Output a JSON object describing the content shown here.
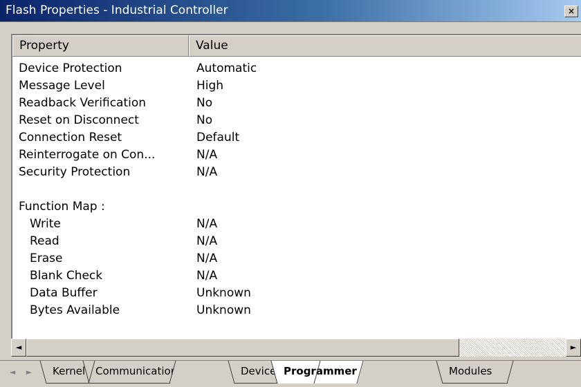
{
  "window": {
    "title": "Flash Properties - Industrial Controller",
    "close_glyph": "×"
  },
  "columns": {
    "property": "Property",
    "value": "Value"
  },
  "rows": [
    {
      "property": "Device Protection",
      "value": "Automatic"
    },
    {
      "property": "Message Level",
      "value": "High"
    },
    {
      "property": "Readback Verification",
      "value": "No"
    },
    {
      "property": "Reset on Disconnect",
      "value": "No"
    },
    {
      "property": "Connection Reset",
      "value": "Default"
    },
    {
      "property": "Reinterrogate on Con...",
      "value": "N/A"
    },
    {
      "property": "Security Protection",
      "value": "N/A"
    },
    {
      "property": "",
      "value": ""
    },
    {
      "property": "Function Map :",
      "value": ""
    },
    {
      "property": "Write",
      "value": "N/A"
    },
    {
      "property": "Read",
      "value": "N/A"
    },
    {
      "property": "Erase",
      "value": "N/A"
    },
    {
      "property": "Blank Check",
      "value": "N/A"
    },
    {
      "property": "Data Buffer",
      "value": "Unknown"
    },
    {
      "property": "Bytes Available",
      "value": "Unknown"
    }
  ],
  "scrollbar": {
    "left_glyph": "◄",
    "right_glyph": "►"
  },
  "tabs": {
    "nav_left_glyph": "◄",
    "nav_right_glyph": "►",
    "kernel": "Kernel",
    "communications": "Communications",
    "device": "Device",
    "programmer": "Programmer",
    "modules": "Modules",
    "active": "Programmer"
  },
  "colors": {
    "titlebar_start": "#0a246a",
    "titlebar_end": "#a6caf0",
    "window_bg": "#d4d0c8",
    "list_bg": "#ffffff"
  }
}
